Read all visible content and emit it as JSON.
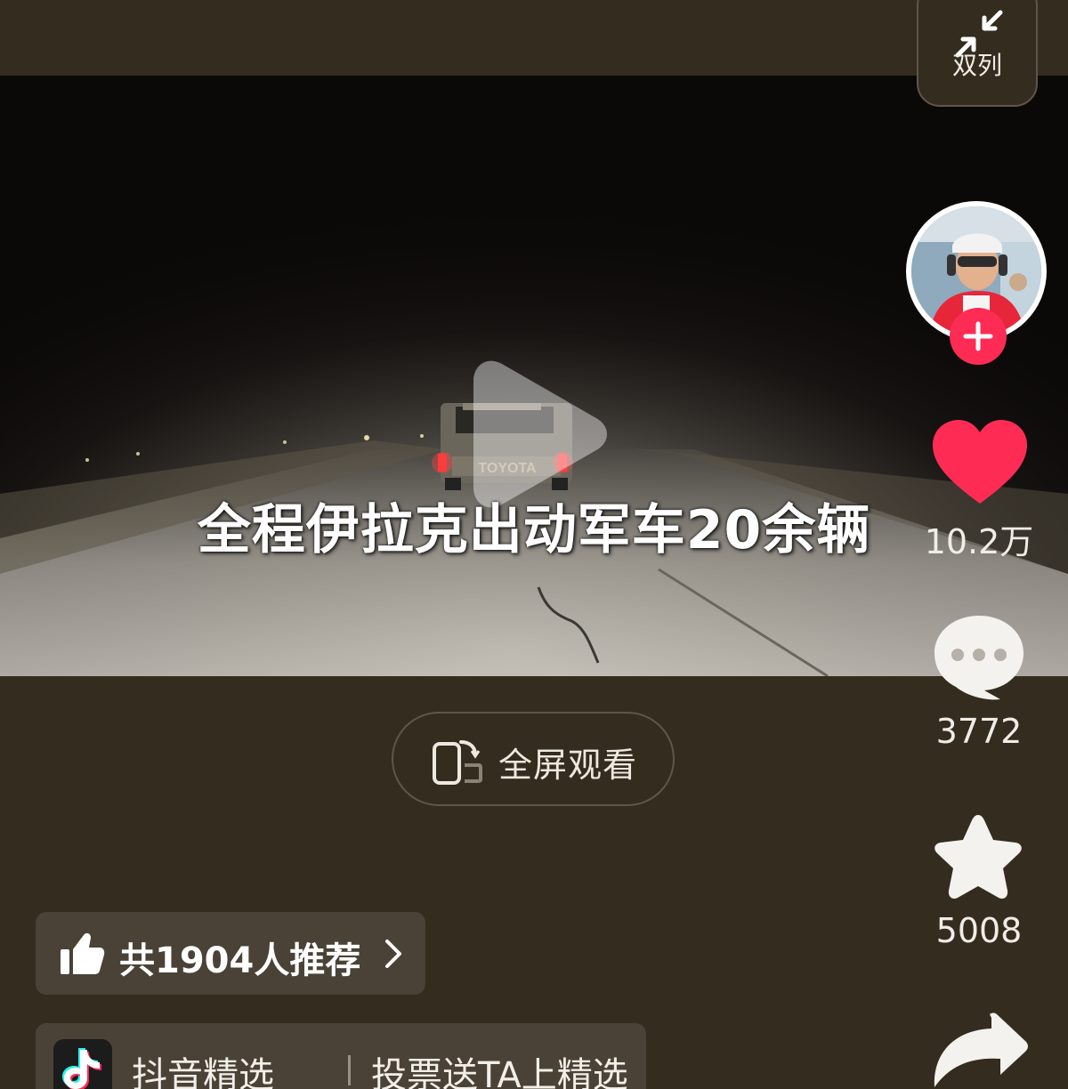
{
  "top_bar": {
    "double_column_label": "双列"
  },
  "video": {
    "caption": "全程伊拉克出动军车20余辆",
    "play_icon": "play-icon"
  },
  "author": {
    "avatar_icon": "avatar-photo",
    "follow_icon": "plus-icon"
  },
  "actions": {
    "like_count": "10.2万",
    "comment_count": "3772",
    "favorite_count": "5008",
    "like_color": "#fe2c55"
  },
  "fullscreen": {
    "label": "全屏观看"
  },
  "recommend": {
    "label": "共1904人推荐"
  },
  "douyin_select": {
    "brand": "抖音精选",
    "cta": "投票送TA上精选"
  },
  "colors": {
    "background": "#342c1e",
    "pill": "#4a4236",
    "accent": "#fe2c55"
  }
}
